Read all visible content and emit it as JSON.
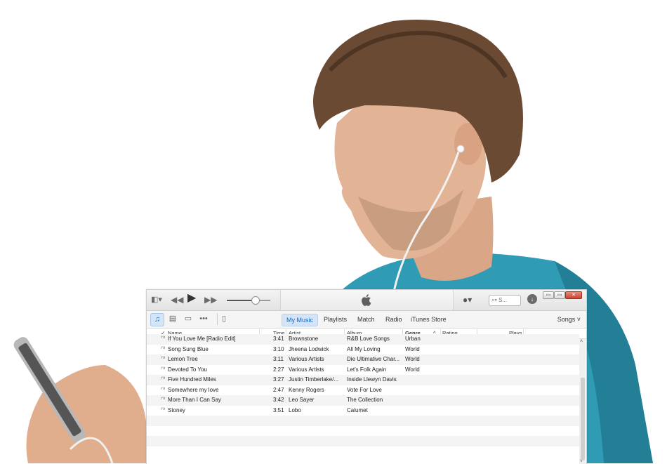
{
  "colors": {
    "accent": "#1e6fc0",
    "shirt": "#2f9bb4"
  },
  "titlebar": {
    "search_placeholder": "S...",
    "apple_icon": "apple-logo-icon",
    "win_minimize": "▭",
    "win_restore": "▭",
    "win_close": "✕"
  },
  "nav": {
    "tabs": [
      {
        "label": "My Music"
      },
      {
        "label": "Playlists"
      },
      {
        "label": "Match"
      },
      {
        "label": "Radio"
      },
      {
        "label": "iTunes Store"
      }
    ],
    "songs_label": "Songs"
  },
  "columns": {
    "check": "✓",
    "name": "Name",
    "time": "Time",
    "artist": "Artist",
    "album": "Album",
    "genre": "Genre",
    "rating": "Rating",
    "plays": "Plays"
  },
  "tracks": [
    {
      "name": "If You Love Me [Radio Edit]",
      "time": "3:41",
      "artist": "Brownstone",
      "album": "R&B Love Songs",
      "genre": "Urban"
    },
    {
      "name": "Song Sung Blue",
      "time": "3:10",
      "artist": "Jheena Lodwick",
      "album": "All My Loving",
      "genre": "World"
    },
    {
      "name": "Lemon Tree",
      "time": "3:11",
      "artist": "Various Artists",
      "album": "Die Ultimative Char...",
      "genre": "World"
    },
    {
      "name": "Devoted To You",
      "time": "2:27",
      "artist": "Various Artists",
      "album": "Let's Folk Again",
      "genre": "World"
    },
    {
      "name": "Five Hundred Miles",
      "time": "3:27",
      "artist": "Justin Timberlake/...",
      "album": "Inside Llewyn Davis",
      "genre": ""
    },
    {
      "name": "Somewhere my love",
      "time": "2:47",
      "artist": "Kenny Rogers",
      "album": "Vote For Love",
      "genre": ""
    },
    {
      "name": "More Than I Can Say",
      "time": "3:42",
      "artist": "Leo Sayer",
      "album": "The Collection",
      "genre": ""
    },
    {
      "name": "Stoney",
      "time": "3:51",
      "artist": "Lobo",
      "album": "Calumet",
      "genre": ""
    }
  ]
}
